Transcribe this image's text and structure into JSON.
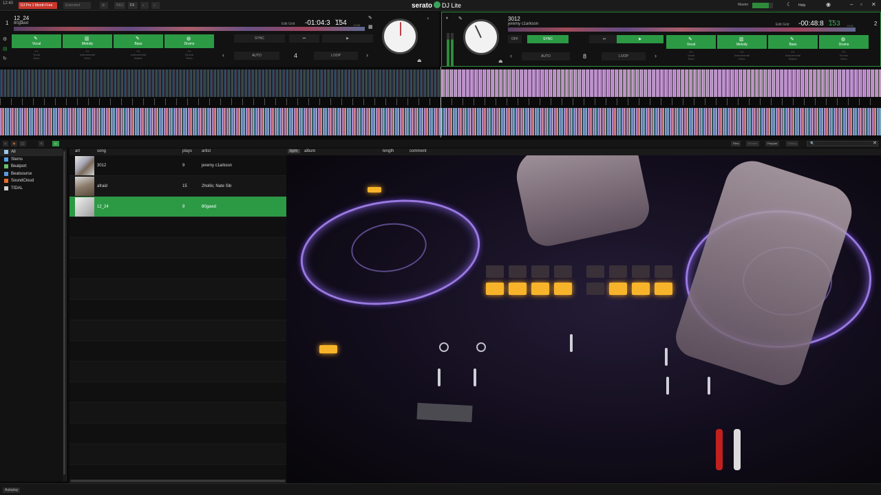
{
  "titlebar": {
    "time": "12:40",
    "promo": "DJ Pro 1 Month Free",
    "extended": "Extended",
    "rec": "REC",
    "fx": "FX",
    "brand": "serato",
    "product": "DJ Lite",
    "master": "Master",
    "help": "Help"
  },
  "deck_left": {
    "number": "1",
    "title": "12_24",
    "artist": "80gawd",
    "time": "-01:04:3",
    "bpm": "154",
    "bpm_unit": "bpm",
    "pitch": "+0.00",
    "edit_grid": "Edit Grid",
    "sync": "SYNC",
    "auto": "AUTO",
    "loop": "LOOP",
    "loop_value": "4",
    "stems": [
      "Vocal",
      "Melody",
      "Bass",
      "Drums"
    ],
    "stem_fx": [
      "FX\nVocal\nEcho",
      "FX\nInstrumental\nEcho",
      "FX\nInstrumental\nBraker",
      "FX\nDrums\nEcho"
    ]
  },
  "deck_right": {
    "number": "2",
    "title": "3012",
    "artist": "jeremy c1arkson",
    "time": "-00:48:8",
    "bpm": "153",
    "bpm_unit": "bpm",
    "pitch": "+2.01",
    "edit_grid": "Edit Grid",
    "off": "OFF",
    "sync": "SYNC",
    "auto": "AUTO",
    "loop": "LOOP",
    "loop_value": "8",
    "stems": [
      "Vocal",
      "Melody",
      "Bass",
      "Drums"
    ],
    "stem_fx": [
      "FX\nVocal\nEcho",
      "FX\nInstrumental\nEcho",
      "FX\nInstrumental\nBraker",
      "FX\nDrums\nEcho"
    ]
  },
  "library": {
    "files": "Files",
    "browse": "Browse",
    "prepare": "Prepare",
    "history": "History",
    "search_placeholder": "🔍"
  },
  "sidebar": {
    "items": [
      {
        "label": "All",
        "color": "#9ac6e8"
      },
      {
        "label": "Stems",
        "color": "#5aa0e8"
      },
      {
        "label": "Beatport",
        "color": "#6ac06a"
      },
      {
        "label": "Beatsource",
        "color": "#5a9ae0"
      },
      {
        "label": "SoundCloud",
        "color": "#e86a2a"
      },
      {
        "label": "TIDAL",
        "color": "#d0d0d0"
      }
    ]
  },
  "table": {
    "columns": {
      "art": "art",
      "song": "song",
      "plays": "plays",
      "artist": "artist",
      "bpm": "bpm",
      "album": "album",
      "length": "length",
      "comment": "comment"
    },
    "rows": [
      {
        "song": "3012",
        "plays": "9",
        "artist": "jeremy c1arkson"
      },
      {
        "song": "afraid",
        "plays": "15",
        "artist": "2hollis; Nate Sib"
      },
      {
        "song": "12_24",
        "plays": "9",
        "artist": "80gawd"
      }
    ]
  },
  "bottombar": {
    "autoplay": "Autoplay"
  }
}
